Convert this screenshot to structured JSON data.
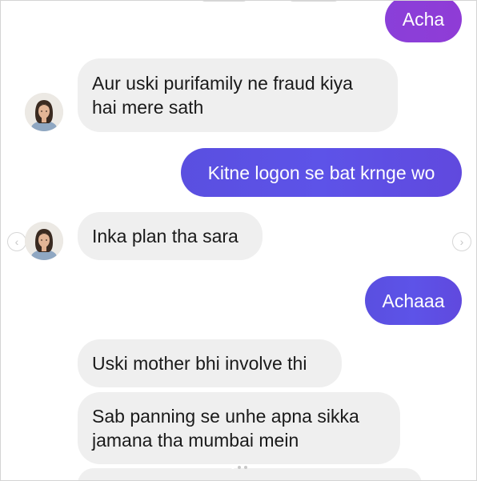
{
  "messages": [
    {
      "text": "Acha",
      "sender": "me"
    },
    {
      "text": "Aur uski purifamily ne fraud kiya\nhai mere sath",
      "sender": "them"
    },
    {
      "text": "Kitne logon se bat krnge wo",
      "sender": "me"
    },
    {
      "text": "Inka plan tha sara",
      "sender": "them"
    },
    {
      "text": "Achaaa",
      "sender": "me"
    },
    {
      "text": "Uski mother bhi involve thi",
      "sender": "them"
    },
    {
      "text": "Sab panning se unhe apna sikka\njamana tha mumbai mein",
      "sender": "them"
    }
  ],
  "nav": {
    "prev_icon": "chevron-left-icon",
    "next_icon": "chevron-right-icon",
    "prev_glyph": "‹",
    "next_glyph": "›"
  },
  "colors": {
    "outgoing_bubble": "#5d53e8",
    "outgoing_bubble_top": "#8f3cd6",
    "incoming_bubble": "#efefef",
    "incoming_text": "#1a1a1a",
    "outgoing_text": "#ffffff"
  }
}
